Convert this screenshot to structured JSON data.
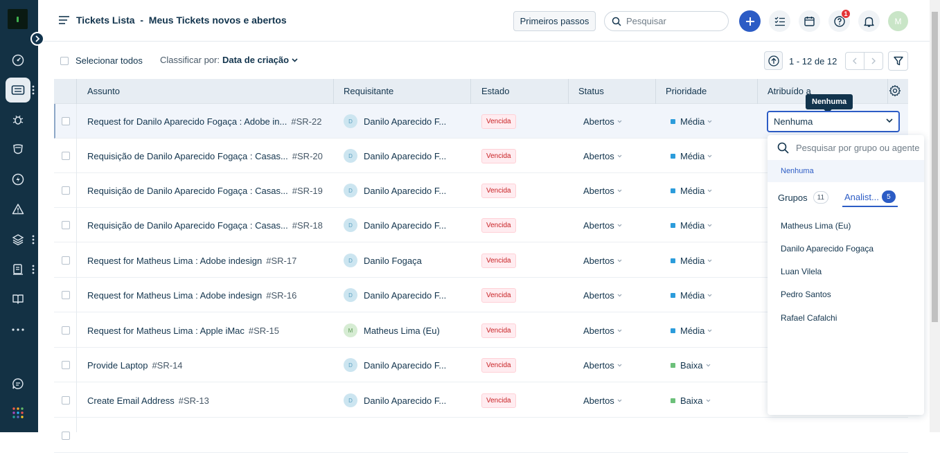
{
  "header": {
    "title": "Tickets Lista  -  Meus Tickets novos e abertos",
    "getting_started": "Primeiros passos",
    "search_placeholder": "Pesquisar",
    "help_badge": "1",
    "avatar_initial": "M"
  },
  "toolbar": {
    "select_all": "Selecionar todos",
    "sort_label": "Classificar por:",
    "sort_value": "Data de criação",
    "pagination": "1 - 12 de 12"
  },
  "columns": [
    "Assunto",
    "Requisitante",
    "Estado",
    "Status",
    "Prioridade",
    "Atribuído a"
  ],
  "rows": [
    {
      "subject": "Request for Danilo Aparecido Fogaça : Adobe in...",
      "id": "#SR-22",
      "requester": "Danilo Aparecido F...",
      "initial": "D",
      "state": "Vencida",
      "status": "Abertos",
      "priority": "Média"
    },
    {
      "subject": "Requisição de Danilo Aparecido Fogaça : Casas...",
      "id": "#SR-20",
      "requester": "Danilo Aparecido F...",
      "initial": "D",
      "state": "Vencida",
      "status": "Abertos",
      "priority": "Média"
    },
    {
      "subject": "Requisição de Danilo Aparecido Fogaça : Casas...",
      "id": "#SR-19",
      "requester": "Danilo Aparecido F...",
      "initial": "D",
      "state": "Vencida",
      "status": "Abertos",
      "priority": "Média"
    },
    {
      "subject": "Requisição de Danilo Aparecido Fogaça : Casas...",
      "id": "#SR-18",
      "requester": "Danilo Aparecido F...",
      "initial": "D",
      "state": "Vencida",
      "status": "Abertos",
      "priority": "Média"
    },
    {
      "subject": "Request for Matheus Lima : Adobe indesign",
      "id": "#SR-17",
      "requester": "Danilo Fogaça",
      "initial": "D",
      "state": "Vencida",
      "status": "Abertos",
      "priority": "Média"
    },
    {
      "subject": "Request for Matheus Lima : Adobe indesign",
      "id": "#SR-16",
      "requester": "Danilo Aparecido F...",
      "initial": "D",
      "state": "Vencida",
      "status": "Abertos",
      "priority": "Média"
    },
    {
      "subject": "Request for Matheus Lima : Apple iMac",
      "id": "#SR-15",
      "requester": "Matheus Lima (Eu)",
      "initial": "M",
      "state": "Vencida",
      "status": "Abertos",
      "priority": "Média"
    },
    {
      "subject": "Provide Laptop",
      "id": "#SR-14",
      "requester": "Danilo Aparecido F...",
      "initial": "D",
      "state": "Vencida",
      "status": "Abertos",
      "priority": "Baixa"
    },
    {
      "subject": "Create Email Address",
      "id": "#SR-13",
      "requester": "Danilo Aparecido F...",
      "initial": "D",
      "state": "Vencida",
      "status": "Abertos",
      "priority": "Baixa"
    }
  ],
  "priority_colors": {
    "Média": "#2c9cdb",
    "Baixa": "#6cc07a"
  },
  "assign": {
    "selected": "Nenhuma",
    "tooltip": "Nenhuma",
    "search_placeholder": "Pesquisar por grupo ou agente",
    "none_option": "Nenhuma",
    "tab_groups": "Grupos",
    "tab_groups_count": "11",
    "tab_agents": "Analist...",
    "tab_agents_count": "5",
    "agents": [
      "Matheus Lima (Eu)",
      "Danilo Aparecido Fogaça",
      "Luan Vilela",
      "Pedro Santos",
      "Rafael Cafalchi"
    ]
  },
  "sidebar_icons": [
    "dashboard-icon",
    "tickets-icon",
    "problems-icon",
    "changes-icon",
    "releases-icon",
    "alerts-icon",
    "assets-icon",
    "projects-icon",
    "solutions-icon",
    "more-icon",
    "chat-icon",
    "apps-icon"
  ]
}
